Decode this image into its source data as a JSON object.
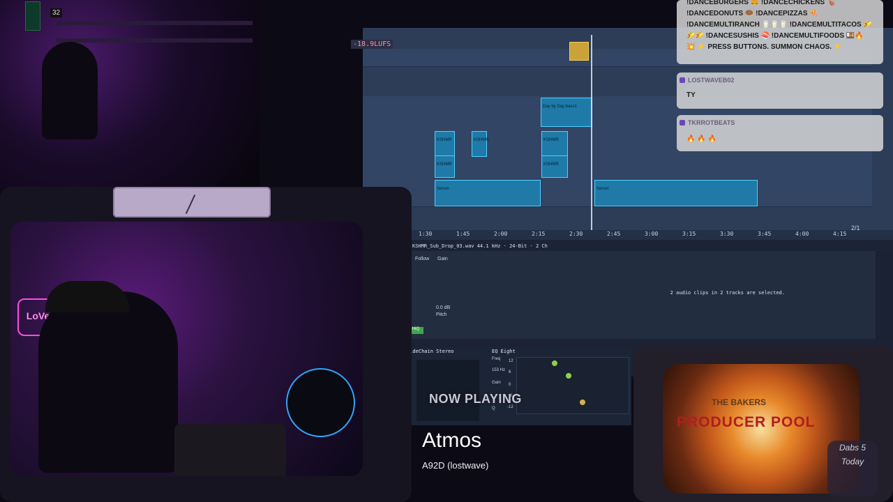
{
  "daw": {
    "lufs_readout": "-18.9LUFS",
    "timeline_ticks": [
      "1:30",
      "1:45",
      "2:00",
      "2:15",
      "2:30",
      "2:45",
      "3:00",
      "3:15",
      "3:30",
      "3:45",
      "4:00",
      "4:15"
    ],
    "page_indicator": "2/1",
    "clip_labels": {
      "kshmr": "KSHMR",
      "serum": "Serum",
      "day_by_day": "Day by Day bass1"
    },
    "clip_detail": {
      "filename": "KSHMR_Sub_Drop_03.wav 44.1 kHz · 24-Bit · 2 Ch",
      "gain_label": "Gain",
      "gain_value": "0.0 dB",
      "pitch_label": "Pitch",
      "follow_label": "Follow",
      "hq_label": "HiQ",
      "selection_message": "2 audio clips in 2 tracks are selected."
    },
    "devices": {
      "sidechain_title": "SideChain Stereo",
      "eq_title": "EQ Eight",
      "freq_label": "Freq",
      "freq_value": "153 Hz",
      "gain_label": "Gain",
      "q_label": "Q",
      "eq_scale": [
        "12",
        "6",
        "0",
        "-6",
        "-12"
      ]
    }
  },
  "now_playing": {
    "label": "NOW PLAYING",
    "title": "Atmos",
    "artist": "A92D (lostwave)"
  },
  "chat": {
    "messages": [
      {
        "user": "",
        "lines": [
          "!DANCEBURGERS 🍔 !DANCECHICKENS 🍗",
          "!DANCEDONUTS 🍩 !DANCEPIZZAS 🍕",
          "!DANCEMULTIRANCH 🥛🥛🥛 !DANCEMULTITACOS 🌮",
          "🌮🌮 !DANCESUSHIS 🍣 !DANCEMULTIFOODS 🍱🔥",
          "💥 ⚡ PRESS BUTTONS. SUMMON CHAOS. ⚡"
        ]
      },
      {
        "user": "LOSTWAVEB02",
        "lines": [
          "TY"
        ]
      },
      {
        "user": "TKRROTBEATS",
        "lines": [
          "🔥 🔥 🔥"
        ]
      }
    ]
  },
  "overlay": {
    "topcam_badge": "32",
    "neon_sign": "LoVe",
    "producer_pool_top": "THE BAKERS",
    "producer_pool": "PRODUCER POOL",
    "logo_text": "Dabs 5 Today"
  },
  "colors": {
    "accent_clip": "#1f7aa8",
    "clip_border": "#4fd0ff",
    "daw_bg": "#2d3d58",
    "chat_bubble": "#d6d6d6"
  }
}
